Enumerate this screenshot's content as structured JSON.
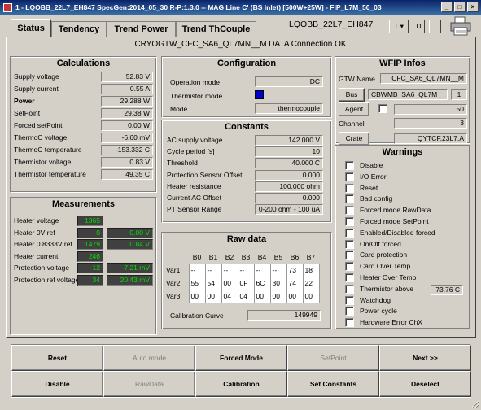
{
  "window": {
    "title": "1 - LQOBB_22L7_EH847 SpecGen:2014_05_30 R-P:1.3.0 -- MAG Line C' (BS Inlet) [500W+25W] - FIP_L7M_50_03",
    "btn_min": "_",
    "btn_max": "□",
    "btn_close": "×"
  },
  "tabs": [
    "Status",
    "Tendency",
    "Trend Power",
    "Trend ThCouple"
  ],
  "device_name": "LQOBB_22L7_EH847",
  "header_buttons": {
    "t": "T",
    "d": "D",
    "i": "I"
  },
  "connection_status": "CRYOGTW_CFC_SA6_QL7MN__M DATA Connection OK",
  "calculations": {
    "title": "Calculations",
    "rows": [
      {
        "label": "Supply voltage",
        "value": "52.83 V",
        "bold": false
      },
      {
        "label": "Supply current",
        "value": "0.55 A",
        "bold": false
      },
      {
        "label": "Power",
        "value": "29.288 W",
        "bold": true
      },
      {
        "label": "SetPoint",
        "value": "29.38 W",
        "bold": false
      },
      {
        "label": "Forced setPoint",
        "value": "0.00 W",
        "bold": false
      },
      {
        "label": "ThermoC voltage",
        "value": "-6.60 mV",
        "bold": false
      },
      {
        "label": "ThermoC temperature",
        "value": "-153.332 C",
        "bold": false
      },
      {
        "label": "Thermistor voltage",
        "value": "0.83 V",
        "bold": false
      },
      {
        "label": "Thermistor temperature",
        "value": "49.35 C",
        "bold": false
      }
    ]
  },
  "measurements": {
    "title": "Measurements",
    "rows": [
      {
        "label": "Heater voltage",
        "raw": "1365",
        "value": ""
      },
      {
        "label": "Heater 0V ref",
        "raw": "0",
        "value": "0.00 V"
      },
      {
        "label": "Heater 0.8333V ref",
        "raw": "1479",
        "value": "0.84 V"
      },
      {
        "label": "Heater current",
        "raw": "246",
        "value": ""
      },
      {
        "label": "Protection voltage",
        "raw": "-12",
        "value": "-7.21 mV"
      },
      {
        "label": "Protection ref voltage",
        "raw": "34",
        "value": "20.43 mV"
      }
    ]
  },
  "configuration": {
    "title": "Configuration",
    "operation_mode_label": "Operation mode",
    "operation_mode": "DC",
    "thermistor_mode_label": "Thermistor mode",
    "mode_label": "Mode",
    "mode": "thermocouple"
  },
  "constants": {
    "title": "Constants",
    "rows": [
      {
        "label": "AC supply voltage",
        "value": "142.000 V"
      },
      {
        "label": "Cycle period [s]",
        "value": "10"
      },
      {
        "label": "Threshold",
        "value": "40.000 C"
      },
      {
        "label": "Protection Sensor Offset",
        "value": "0.000"
      },
      {
        "label": "Heater resistance",
        "value": "100.000 ohm"
      },
      {
        "label": "Current AC Offset",
        "value": "0.000"
      },
      {
        "label": "PT Sensor Range",
        "value": "0-200 ohm - 100 uA"
      }
    ]
  },
  "raw_data": {
    "title": "Raw data",
    "columns": [
      "B0",
      "B1",
      "B2",
      "B3",
      "B4",
      "B5",
      "B6",
      "B7"
    ],
    "rows": [
      {
        "label": "Var1",
        "cells": [
          "--",
          "--",
          "--",
          "--",
          "--",
          "--",
          "73",
          "18"
        ]
      },
      {
        "label": "Var2",
        "cells": [
          "55",
          "54",
          "00",
          "0F",
          "6C",
          "30",
          "74",
          "22"
        ]
      },
      {
        "label": "Var3",
        "cells": [
          "00",
          "00",
          "04",
          "04",
          "00",
          "00",
          "00",
          "00"
        ]
      }
    ],
    "calibration_label": "Calibration Curve",
    "calibration_value": "149949"
  },
  "wfip": {
    "title": "WFIP Infos",
    "gtw_label": "GTW Name",
    "gtw_value": "CFC_SA6_QL7MN__M",
    "bus_label": "Bus",
    "bus_value": "CBWMB_SA6_QL7M",
    "bus_num": "1",
    "agent_label": "Agent",
    "agent_value": "50",
    "channel_label": "Channel",
    "channel_value": "3",
    "crate_label": "Crate",
    "crate_value": "QYTCF.23L7.A"
  },
  "warnings": {
    "title": "Warnings",
    "items": [
      "Disable",
      "I/O Error",
      "Reset",
      "Bad config",
      "Forced mode RawData",
      "Forced mode SetPoint",
      "Enabled/Disabled forced",
      "On/Off forced",
      "Card protection",
      "Card Over Temp",
      "Heater Over Temp",
      "Thermistor above",
      "Watchdog",
      "Power cycle",
      "Hardware Error ChX"
    ],
    "thermistor_above_value": "73.76 C"
  },
  "actions": {
    "row1": [
      {
        "label": "Reset",
        "enabled": true
      },
      {
        "label": "Auto mode",
        "enabled": false
      },
      {
        "label": "Forced Mode",
        "enabled": true
      },
      {
        "label": "SetPoint",
        "enabled": false
      },
      {
        "label": "Next >>",
        "enabled": true
      }
    ],
    "row2": [
      {
        "label": "Disable",
        "enabled": true
      },
      {
        "label": "RawData",
        "enabled": false
      },
      {
        "label": "Calibration",
        "enabled": true
      },
      {
        "label": "Set Constants",
        "enabled": true
      },
      {
        "label": "Deselect",
        "enabled": true
      }
    ]
  }
}
